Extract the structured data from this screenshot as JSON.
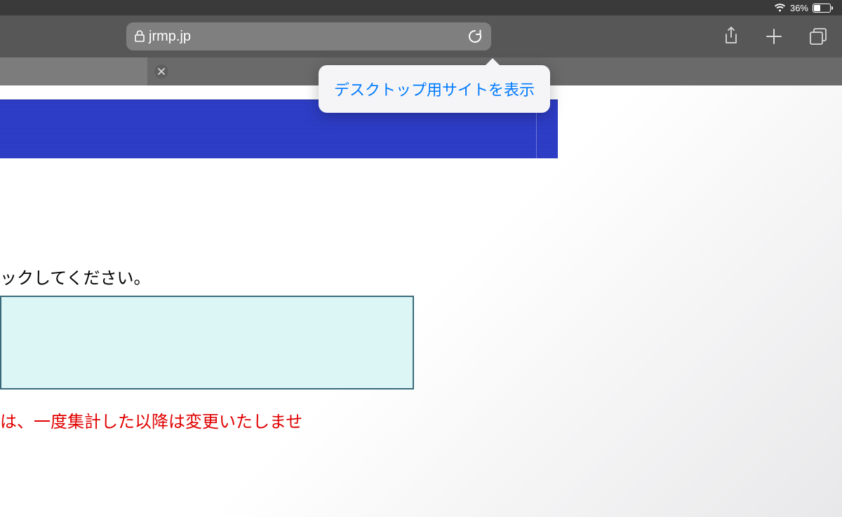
{
  "status_bar": {
    "battery_percent": "36%",
    "battery_fill_percent": 36
  },
  "toolbar": {
    "address": "jrmp.jp"
  },
  "popover": {
    "label": "デスクトップ用サイトを表示"
  },
  "content": {
    "instruction_text": "ックしてください。",
    "red_text": "は、一度集計した以降は変更いたしませ"
  }
}
